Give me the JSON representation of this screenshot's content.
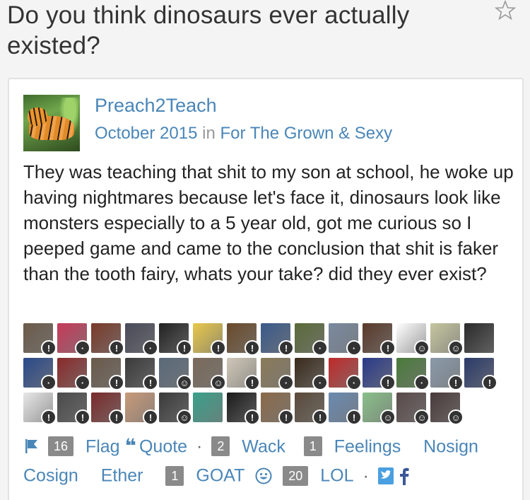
{
  "question": {
    "title": "Do you think dinosaurs ever actually existed?"
  },
  "post": {
    "username": "Preach2Teach",
    "date": "October 2015",
    "in_word": "in",
    "category": "For The Grown & Sexy",
    "body": "They was teaching that shit to my son at school, he woke up having nightmares because let's face it, dinosaurs look like monsters especially to a 5 year old, got me curious so I peeped game and came to the conclusion that shit is faker than the tooth fairy, whats your take? did they ever exist?"
  },
  "reactions": {
    "rows": [
      [
        {
          "icon": "avatar-photo",
          "color": "#6b5b4a",
          "badge": "!",
          "badge_color": "#333"
        },
        {
          "icon": "avatar-photo",
          "color": "#c73a5a",
          "badge": "·",
          "badge_color": "#333"
        },
        {
          "icon": "avatar-photo",
          "color": "#7a3a2a",
          "badge": "!",
          "badge_color": "#333"
        },
        {
          "icon": "avatar-photo",
          "color": "#4a4a5a",
          "badge": "·",
          "badge_color": "#333"
        },
        {
          "icon": "avatar-photo",
          "color": "#222222",
          "badge": "!",
          "badge_color": "#333"
        },
        {
          "icon": "avatar-photo",
          "color": "#e8c84a",
          "badge": "!",
          "badge_color": "#333"
        },
        {
          "icon": "avatar-photo",
          "color": "#6a4a2a",
          "badge": "!",
          "badge_color": "#333"
        },
        {
          "icon": "avatar-photo",
          "color": "#3a5a8a",
          "badge": "!",
          "badge_color": "#333"
        },
        {
          "icon": "avatar-photo",
          "color": "#5a6a3a",
          "badge": "·",
          "badge_color": "#333"
        },
        {
          "icon": "avatar-photo",
          "color": "#7a8aa0",
          "badge": "·",
          "badge_color": "#333"
        },
        {
          "icon": "avatar-photo",
          "color": "#5a3a2a",
          "badge": "!",
          "badge_color": "#333"
        },
        {
          "icon": "avatar-photo",
          "color": "#ffffff",
          "badge": "☺",
          "badge_color": "#333"
        },
        {
          "icon": "avatar-photo",
          "color": "#c6c6a0",
          "badge": "☺",
          "badge_color": "#333"
        },
        {
          "icon": "avatar-photo",
          "color": "#2a2a2a",
          "badge": "",
          "badge_color": "#333"
        }
      ],
      [
        {
          "icon": "avatar-photo",
          "color": "#2a4a8a",
          "badge": "·",
          "badge_color": "#333"
        },
        {
          "icon": "avatar-photo",
          "color": "#8a2a2a",
          "badge": "·",
          "badge_color": "#333"
        },
        {
          "icon": "avatar-photo",
          "color": "#6a5a4a",
          "badge": "!",
          "badge_color": "#333"
        },
        {
          "icon": "avatar-photo",
          "color": "#3a3a3a",
          "badge": "!",
          "badge_color": "#333"
        },
        {
          "icon": "avatar-photo",
          "color": "#5a6a7a",
          "badge": "☺",
          "badge_color": "#333"
        },
        {
          "icon": "avatar-photo",
          "color": "#7a6a5a",
          "badge": "☺",
          "badge_color": "#333"
        },
        {
          "icon": "avatar-photo",
          "color": "#d0c8b8",
          "badge": "!",
          "badge_color": "#333"
        },
        {
          "icon": "avatar-photo",
          "color": "#8a7a5a",
          "badge": "·",
          "badge_color": "#333"
        },
        {
          "icon": "avatar-photo",
          "color": "#3a2a1a",
          "badge": "·",
          "badge_color": "#333"
        },
        {
          "icon": "avatar-photo",
          "color": "#c02a2a",
          "badge": "·",
          "badge_color": "#333"
        },
        {
          "icon": "avatar-photo",
          "color": "#2a3a8a",
          "badge": "!",
          "badge_color": "#333"
        },
        {
          "icon": "avatar-photo",
          "color": "#4a7a3a",
          "badge": "·",
          "badge_color": "#333"
        },
        {
          "icon": "avatar-photo",
          "color": "#8a9aaa",
          "badge": "!",
          "badge_color": "#333"
        },
        {
          "icon": "avatar-photo",
          "color": "#2a3a6a",
          "badge": "!",
          "badge_color": "#333"
        }
      ],
      [
        {
          "icon": "avatar-photo",
          "color": "#e8e8e8",
          "badge": "!",
          "badge_color": "#333"
        },
        {
          "icon": "avatar-photo",
          "color": "#4a4a4a",
          "badge": "!",
          "badge_color": "#333"
        },
        {
          "icon": "avatar-photo",
          "color": "#7a2a2a",
          "badge": "!",
          "badge_color": "#333"
        },
        {
          "icon": "avatar-photo",
          "color": "#c89a7a",
          "badge": "!",
          "badge_color": "#333"
        },
        {
          "icon": "avatar-photo",
          "color": "#3a3a3a",
          "badge": "☺",
          "badge_color": "#333"
        },
        {
          "icon": "avatar-photo",
          "color": "#3aa08a",
          "badge": "",
          "badge_color": "#333"
        },
        {
          "icon": "avatar-photo",
          "color": "#1a1a1a",
          "badge": "!",
          "badge_color": "#333"
        },
        {
          "icon": "avatar-photo",
          "color": "#8a6a4a",
          "badge": "!",
          "badge_color": "#333"
        },
        {
          "icon": "avatar-photo",
          "color": "#5a4a3a",
          "badge": "!",
          "badge_color": "#333"
        },
        {
          "icon": "avatar-photo",
          "color": "#6a8ab0",
          "badge": "!",
          "badge_color": "#333"
        },
        {
          "icon": "avatar-photo",
          "color": "#8ac08a",
          "badge": "☺",
          "badge_color": "#333"
        },
        {
          "icon": "avatar-photo",
          "color": "#5a4a4a",
          "badge": "☺",
          "badge_color": "#333"
        },
        {
          "icon": "avatar-photo",
          "color": "#4a3a3a",
          "badge": "☺",
          "badge_color": "#333"
        }
      ]
    ]
  },
  "footer": {
    "flag_count": "16",
    "flag_label": "Flag",
    "quote_label": "Quote",
    "dot": "·",
    "wack_count": "2",
    "wack_label": "Wack",
    "feelings_count": "1",
    "feelings_label": "Feelings",
    "nosign_label": "Nosign",
    "cosign_label": "Cosign",
    "ether_label": "Ether",
    "goat_count": "1",
    "goat_label": "GOAT",
    "lol_count": "20",
    "lol_label": "LOL",
    "dot2": "·"
  },
  "colors": {
    "link": "#4a86b8",
    "count_bg": "#8a8a8a",
    "facebook_blue": "#3b5998",
    "twitter_blue": "#4a9fe0"
  }
}
